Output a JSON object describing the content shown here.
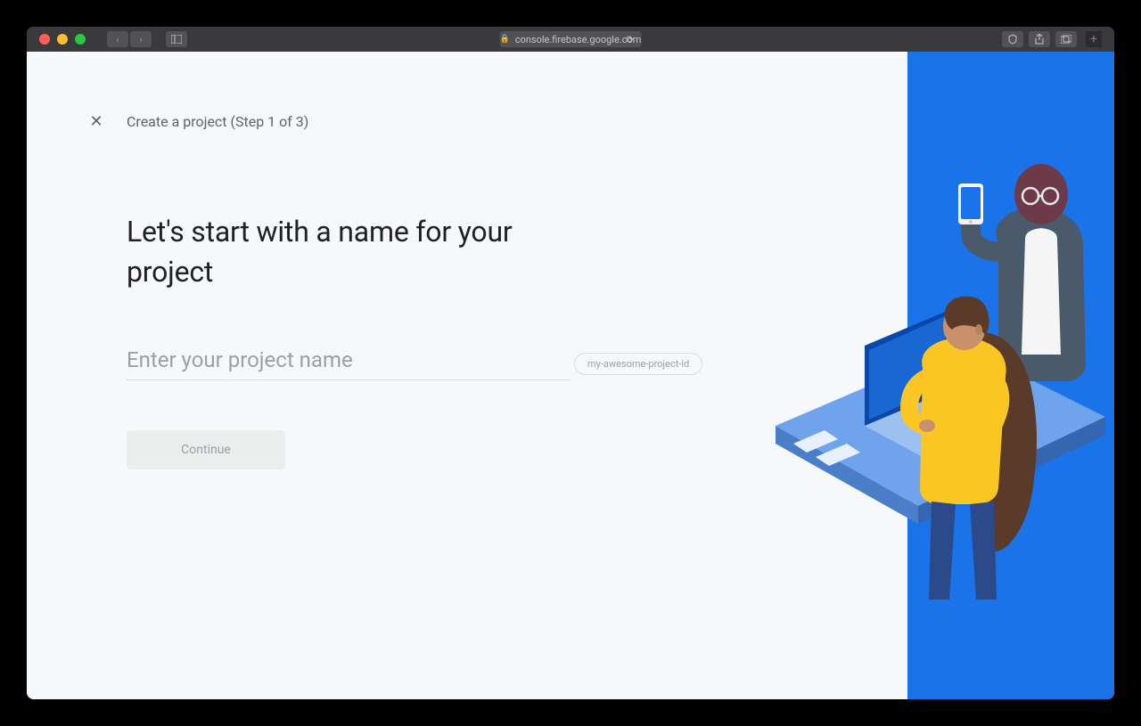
{
  "browser": {
    "url": "console.firebase.google.com"
  },
  "header": {
    "breadcrumb": "Create a project (Step 1 of 3)"
  },
  "main": {
    "title": "Let's start with a name for your project",
    "project_name_placeholder": "Enter your project name",
    "project_id_placeholder": "my-awesome-project-id",
    "continue_label": "Continue"
  },
  "colors": {
    "accent": "#1a73e8",
    "text_primary": "#202124",
    "text_secondary": "#5f6368",
    "text_muted": "#9aa0a6"
  }
}
